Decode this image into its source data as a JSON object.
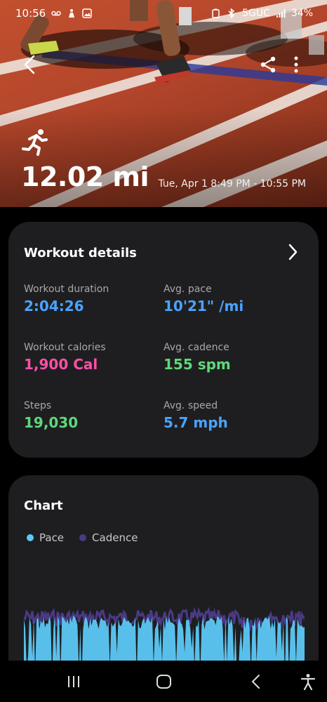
{
  "status": {
    "time": "10:56",
    "network": "5GUC",
    "battery": "34%"
  },
  "workout": {
    "distance": "12.02 mi",
    "date_range": "Tue, Apr 1 8:49 PM - 10:55 PM",
    "activity_icon": "running-icon"
  },
  "details": {
    "title": "Workout details",
    "metrics": [
      {
        "label": "Workout duration",
        "value": "2:04:26",
        "color": "#4aa3ff"
      },
      {
        "label": "Avg. pace",
        "value": "10'21\" /mi",
        "color": "#4aa3ff"
      },
      {
        "label": "Workout calories",
        "value": "1,900 Cal",
        "color": "#ff4fa8"
      },
      {
        "label": "Avg. cadence",
        "value": "155 spm",
        "color": "#5ed879"
      },
      {
        "label": "Steps",
        "value": "19,030",
        "color": "#5ed879"
      },
      {
        "label": "Avg. speed",
        "value": "5.7 mph",
        "color": "#4aa3ff"
      }
    ]
  },
  "chart": {
    "title": "Chart",
    "legend": [
      {
        "name": "Pace",
        "color": "#5cc8f5"
      },
      {
        "name": "Cadence",
        "color": "#4a3a86"
      }
    ]
  },
  "icons": {
    "back": "back-arrow-icon",
    "share": "share-icon",
    "more": "more-vertical-icon",
    "chevron": "chevron-right-icon",
    "nav_recents": "recents-icon",
    "nav_home": "home-icon",
    "nav_back": "nav-back-icon",
    "nav_accessibility": "accessibility-icon"
  }
}
